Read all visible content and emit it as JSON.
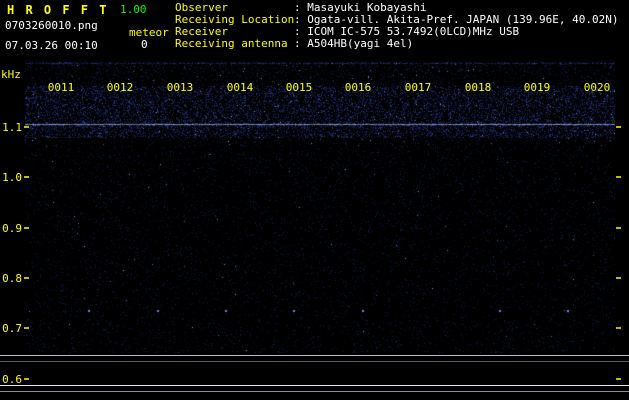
{
  "header": {
    "app_title": "H R O F F T",
    "version": "1.00",
    "filename": "0703260010.png",
    "mode_label": "meteor",
    "datetime": "07.03.26 00:10",
    "meteor_count": "0",
    "info_rows": [
      {
        "label": "Observer",
        "value": ": Masayuki Kobayashi"
      },
      {
        "label": "Receiving Location",
        "value": ": Ogata-vill. Akita-Pref. JAPAN (139.96E, 40.02N)"
      },
      {
        "label": "Receiver",
        "value": ": ICOM IC-575 53.7492(0LCD)MHz USB"
      },
      {
        "label": "Receiving antenna",
        "value": ": A504HB(yagi 4el)"
      }
    ]
  },
  "colors": {
    "label_yellow": "#ffff00",
    "value_white": "#ffffff",
    "version_green": "#00ff00",
    "background": "#000000"
  },
  "chart_data": {
    "type": "heatmap",
    "ylabel": "kHz",
    "x_tick_labels": [
      "0011",
      "0012",
      "0013",
      "0014",
      "0015",
      "0016",
      "0017",
      "0018",
      "0019",
      "0020"
    ],
    "y_tick_labels": [
      "1.1",
      "1.0",
      "0.9",
      "0.8",
      "0.7",
      "0.6"
    ],
    "ylim_khz": [
      0.55,
      1.23
    ],
    "carrier_line_khz": 1.1,
    "meteor_echo_count": 0,
    "legend": "off",
    "grid": "off",
    "noise": {
      "background": "#000000",
      "dot_color": "#2a46d2",
      "band_color": "#3c5feb",
      "bright_color": "#78a0ff",
      "carrier_color": "#96aff5"
    },
    "signal_strip": {
      "description": "flat signal-level trace at bottom, no meteor spikes"
    }
  }
}
